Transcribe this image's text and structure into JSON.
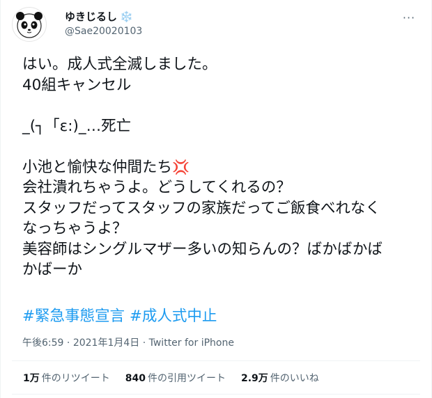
{
  "user": {
    "display_name": "ゆきじるし",
    "badge": "❄️",
    "handle": "@Sae20020103",
    "avatar_icon": "panda-avatar-icon"
  },
  "menu_icon": "more-horizontal-icon",
  "tweet": {
    "lines": [
      "はい。成人式全滅しました。",
      "40組キャンセル",
      "",
      "_(┐「ε:)_…死亡",
      "",
      "小池と愉快な仲間たち",
      "会社潰れちゃうよ。どうしてくれるの？",
      "スタッフだってスタッフの家族だってご飯食べれなく",
      "なっちゃうよ？",
      "美容師はシングルマザー多いの知らんの？ばかばかば",
      "かばーか"
    ],
    "anger_emoji": "💢",
    "hashtags": [
      "#緊急事態宣言",
      "#成人式中止"
    ]
  },
  "meta": {
    "time": "午後6:59",
    "date": "2021年1月4日",
    "source": "Twitter for iPhone",
    "separator": " · "
  },
  "stats": {
    "retweets_count": "1万",
    "retweets_label": "件のリツイート",
    "quotes_count": "840",
    "quotes_label": "件の引用ツイート",
    "likes_count": "2.9万",
    "likes_label": "件のいいね"
  },
  "colors": {
    "link": "#1d9bf0",
    "secondary": "#536471",
    "primary": "#0f1419",
    "divider": "#eff3f4"
  }
}
